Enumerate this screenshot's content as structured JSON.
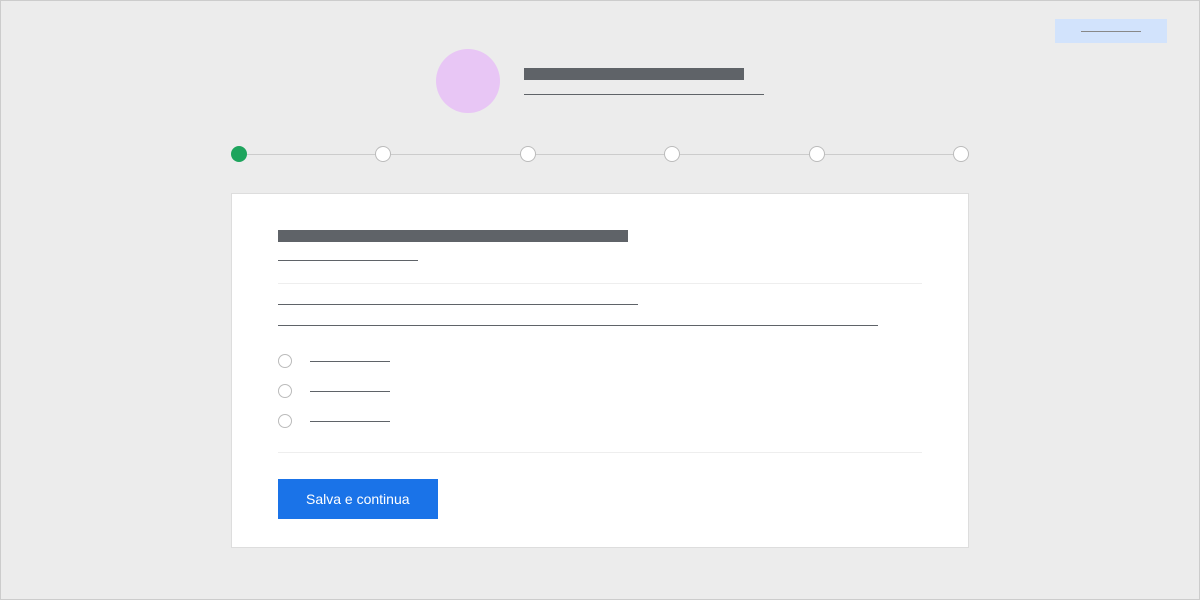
{
  "top_badge": {
    "label": ""
  },
  "header": {
    "title": "",
    "subtitle": ""
  },
  "stepper": {
    "steps": [
      {
        "active": true
      },
      {
        "active": false
      },
      {
        "active": false
      },
      {
        "active": false
      },
      {
        "active": false
      },
      {
        "active": false
      }
    ]
  },
  "card": {
    "title": "",
    "subtitle": "",
    "field_label": "",
    "field_value": "",
    "options": [
      {
        "label": ""
      },
      {
        "label": ""
      },
      {
        "label": ""
      }
    ],
    "submit_label": "Salva e continua"
  }
}
